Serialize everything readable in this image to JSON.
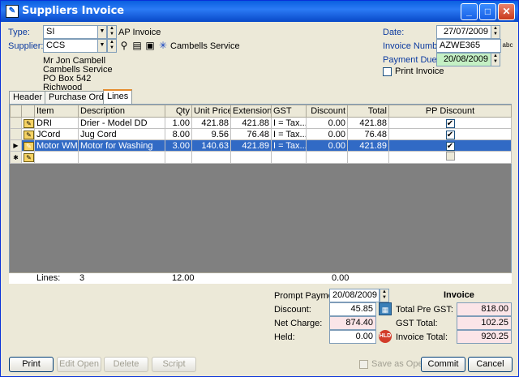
{
  "window": {
    "title": "Suppliers Invoice",
    "controls": {
      "minimize": "_",
      "maximize": "□",
      "close": "✕"
    }
  },
  "header": {
    "type_label": "Type:",
    "type_value": "SI",
    "type_desc": "AP Invoice",
    "supplier_label": "Supplier:",
    "supplier_value": "CCS",
    "supplier_name": "Cambells Service",
    "address": [
      "Mr Jon Cambell",
      "Cambells Service",
      "PO Box 542",
      "Richwood"
    ],
    "date_label": "Date:",
    "date_value": "27/07/2009",
    "invoice_number_label": "Invoice Number:",
    "invoice_number_value": "AZWE365",
    "payment_due_label": "Payment Due:",
    "payment_due_value": "20/08/2009",
    "print_invoice_label": "Print Invoice"
  },
  "tabs": [
    {
      "label": "Header",
      "active": false
    },
    {
      "label": "Purchase Orders",
      "active": false
    },
    {
      "label": "Lines",
      "active": true
    }
  ],
  "grid": {
    "columns": [
      "Item",
      "Description",
      "Qty",
      "Unit Price",
      "Extension",
      "GST",
      "Discount",
      "Total",
      "PP Discount"
    ],
    "rows": [
      {
        "item": "DRI",
        "description": "Drier - Model DD",
        "qty": "1.00",
        "unit_price": "421.88",
        "extension": "421.88",
        "gst": "I = Tax...",
        "discount": "0.00",
        "total": "421.88",
        "pp_discount": "✔"
      },
      {
        "item": "JCord",
        "description": "Jug Cord",
        "qty": "8.00",
        "unit_price": "9.56",
        "extension": "76.48",
        "gst": "I = Tax...",
        "discount": "0.00",
        "total": "76.48",
        "pp_discount": "✔"
      },
      {
        "item": "Motor WM",
        "description": "Motor for Washing",
        "qty": "3.00",
        "unit_price": "140.63",
        "extension": "421.89",
        "gst": "I = Tax...",
        "discount": "0.00",
        "total": "421.89",
        "pp_discount": "✔"
      }
    ],
    "footer": {
      "lines_label": "Lines:",
      "lines_count": "3",
      "qty_total": "12.00",
      "discount_total": "0.00"
    }
  },
  "summary": {
    "prompt_payment_label": "Prompt Payment:",
    "prompt_payment_value": "20/08/2009",
    "discount_label": "Discount:",
    "discount_value": "45.85",
    "net_charge_label": "Net Charge:",
    "net_charge_value": "874.40",
    "held_label": "Held:",
    "held_value": "0.00",
    "invoice_heading": "Invoice",
    "total_pre_gst_label": "Total Pre GST:",
    "total_pre_gst_value": "818.00",
    "gst_total_label": "GST Total:",
    "gst_total_value": "102.25",
    "invoice_total_label": "Invoice Total:",
    "invoice_total_value": "920.25"
  },
  "buttons": {
    "print": "Print",
    "edit_open": "Edit Open",
    "delete": "Delete",
    "script": "Script",
    "save_as_open": "Save as Open",
    "commit": "Commit",
    "cancel": "Cancel"
  },
  "colors": {
    "selection": "#316ac5",
    "title_bar": "#0a5fe0",
    "label": "#0b3aa0"
  }
}
